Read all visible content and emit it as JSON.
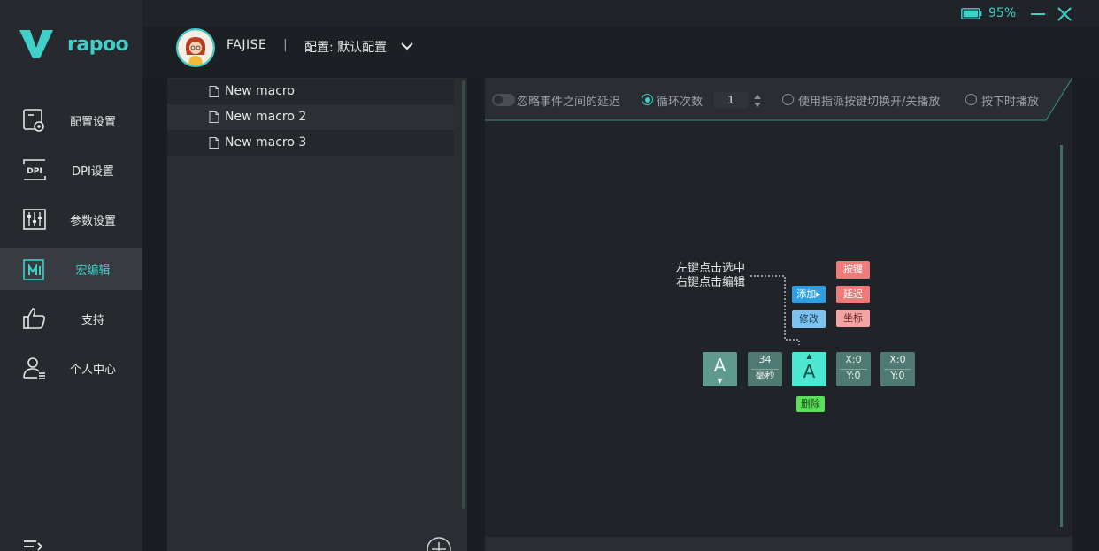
{
  "sidebar": {
    "logo_text": "rapoo",
    "items": [
      {
        "label": "配置设置",
        "icon": "gear-profile-icon"
      },
      {
        "label": "DPI设置",
        "icon": "dpi-icon"
      },
      {
        "label": "参数设置",
        "icon": "sliders-icon"
      },
      {
        "label": "宏编辑",
        "icon": "macro-icon",
        "active": true
      },
      {
        "label": "支持",
        "icon": "thumbs-up-icon"
      },
      {
        "label": "个人中心",
        "icon": "user-icon"
      }
    ]
  },
  "header": {
    "username": "FAJISE",
    "separator": "|",
    "profile_label": "配置: 默认配置",
    "battery": "95%"
  },
  "macros": {
    "items": [
      "New macro",
      "New macro 2",
      "New macro 3"
    ]
  },
  "options": {
    "ignore_delay": "忽略事件之间的延迟",
    "loop_count": "循环次数",
    "loop_value": "1",
    "toggle_play": "使用指派按键切换开/关播放",
    "press_play": "按下时播放"
  },
  "guide": {
    "hint_line1": "左键点击选中",
    "hint_line2": "右键点击编辑",
    "add": "添加▸",
    "edit": "修改",
    "key": "按键",
    "delay": "延迟",
    "coord": "坐标",
    "delete": "删除",
    "block_a_down": "A",
    "block_a_down_arrow": "▼",
    "delay_value": "34",
    "delay_unit": "毫秒",
    "block_a_up": "A",
    "block_a_up_arrow": "▲",
    "xy1_x": "X:0",
    "xy1_y": "Y:0",
    "xy2_x": "X:0",
    "xy2_y": "Y:0"
  },
  "colors": {
    "accent": "#3fd0c9",
    "sidebar_bg": "#26292d",
    "active_bg": "#383c41"
  }
}
